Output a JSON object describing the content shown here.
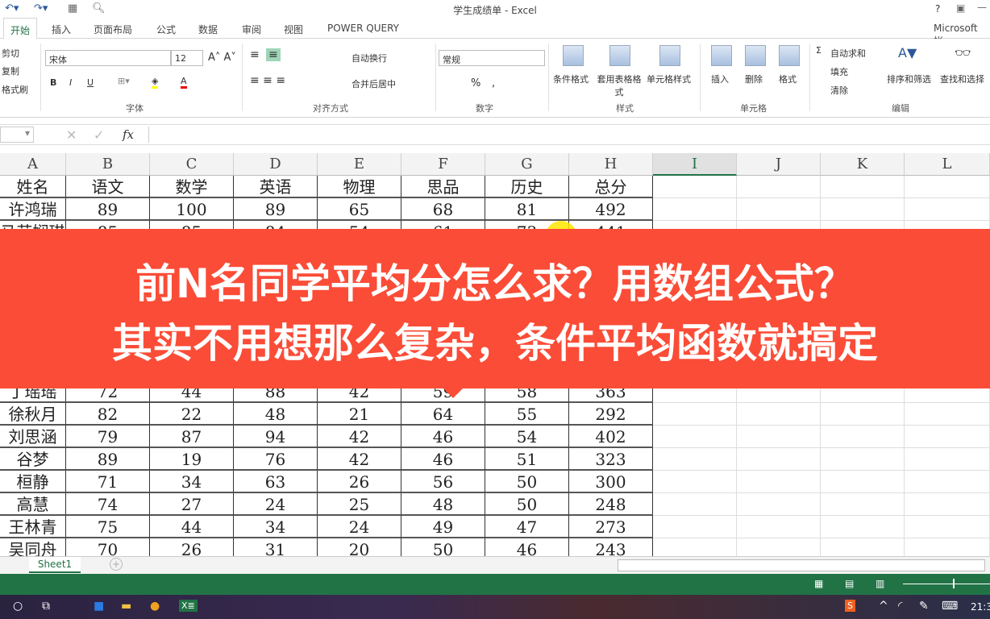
{
  "window": {
    "title": "学生成绩单 - Excel",
    "help": "?",
    "account": "Microsoft 帐"
  },
  "tabs": [
    "开始",
    "插入",
    "页面布局",
    "公式",
    "数据",
    "审阅",
    "视图",
    "POWER QUERY"
  ],
  "ribbon": {
    "clipboard": {
      "cut": "剪切",
      "copy": "复制",
      "painter": "格式刷"
    },
    "font": {
      "name": "宋体",
      "size": "12",
      "group": "字体",
      "bold": "B",
      "italic": "I",
      "underline": "U"
    },
    "align": {
      "wrap": "自动换行",
      "merge": "合并后居中",
      "group": "对齐方式"
    },
    "number": {
      "format": "常规",
      "percent": "%",
      "comma": ",",
      "group": "数字"
    },
    "styles": {
      "cond": "条件格式",
      "table": "套用表格格式",
      "cell": "单元格样式",
      "group": "样式"
    },
    "cells": {
      "insert": "插入",
      "delete": "删除",
      "format": "格式",
      "group": "单元格"
    },
    "editing": {
      "autosum": "自动求和",
      "fill": "填充",
      "clear": "清除",
      "sort": "排序和筛选",
      "find": "查找和选择",
      "group": "编辑"
    }
  },
  "formula_bar": {
    "fx": "fx",
    "value": ""
  },
  "columns": [
    "A",
    "B",
    "C",
    "D",
    "E",
    "F",
    "G",
    "H",
    "I",
    "J",
    "K",
    "L"
  ],
  "selected_column": "I",
  "header_row": [
    "姓名",
    "语文",
    "数学",
    "英语",
    "物理",
    "思品",
    "历史",
    "总分"
  ],
  "rows_top": [
    [
      "许鸿瑞",
      "89",
      "100",
      "89",
      "65",
      "68",
      "81",
      "492"
    ],
    [
      "马芸娴琪",
      "85",
      "85",
      "84",
      "54",
      "61",
      "73",
      "441"
    ]
  ],
  "rows_bottom": [
    [
      "丁瑶瑶",
      "72",
      "44",
      "88",
      "42",
      "59",
      "58",
      "363"
    ],
    [
      "徐秋月",
      "82",
      "22",
      "48",
      "21",
      "64",
      "55",
      "292"
    ],
    [
      "刘思涵",
      "79",
      "87",
      "94",
      "42",
      "46",
      "54",
      "402"
    ],
    [
      "谷梦",
      "89",
      "19",
      "76",
      "42",
      "46",
      "51",
      "323"
    ],
    [
      "桓静",
      "71",
      "34",
      "63",
      "26",
      "56",
      "50",
      "300"
    ],
    [
      "高慧",
      "74",
      "27",
      "24",
      "25",
      "48",
      "50",
      "248"
    ],
    [
      "王林青",
      "75",
      "44",
      "34",
      "24",
      "49",
      "47",
      "273"
    ],
    [
      "吴同舟",
      "70",
      "26",
      "31",
      "20",
      "50",
      "46",
      "243"
    ]
  ],
  "banner": {
    "line1": "前N名同学平均分怎么求？用数组公式？",
    "line2": "其实不用想那么复杂，条件平均函数就搞定",
    "color": "#fb4c37"
  },
  "sheet": {
    "tab": "Sheet1",
    "add": "+"
  },
  "taskbar": {
    "clock": "21:3"
  },
  "accent": "#217346"
}
